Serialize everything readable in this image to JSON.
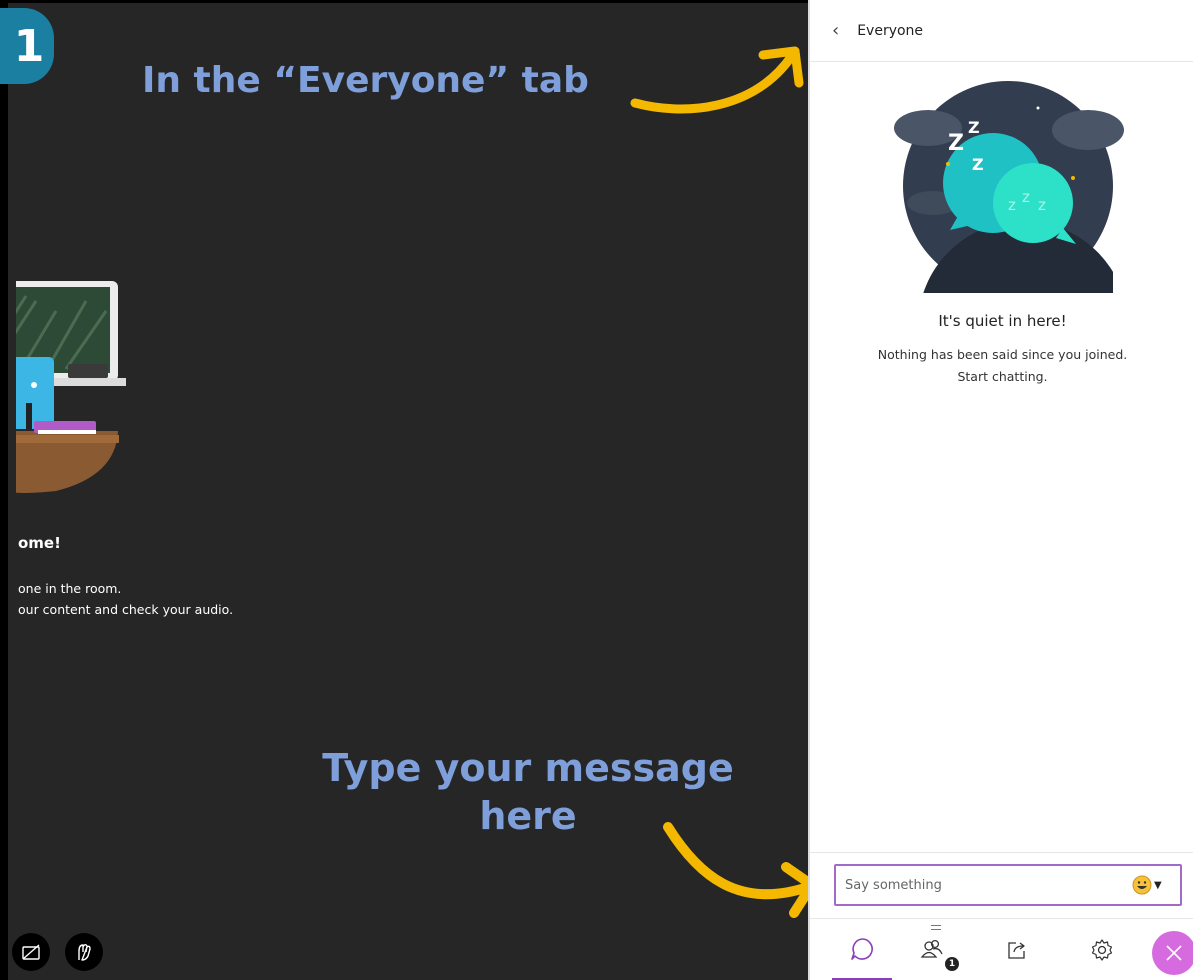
{
  "annotations": {
    "step_number": "1",
    "top_callout": "In the “Everyone” tab",
    "bottom_callout": "Type your message here",
    "arrow_color": "#f5b800",
    "callout_color": "#7e9fd9"
  },
  "stage": {
    "welcome_title": "ome!",
    "welcome_line1": "one in the room.",
    "welcome_line2": "our content and check your audio.",
    "buttons": [
      {
        "icon": "camera-off-icon"
      },
      {
        "icon": "raise-hand-icon"
      }
    ]
  },
  "panel": {
    "back_icon": "chevron-left-icon",
    "title": "Everyone",
    "empty_state": {
      "title": "It's quiet in here!",
      "line1": "Nothing has been said since you joined.",
      "line2": "Start chatting."
    },
    "composer": {
      "placeholder": "Say something",
      "emoji_icon": "emoji-smile-icon"
    },
    "tabs": [
      {
        "icon": "chat-bubble-icon",
        "active": true
      },
      {
        "icon": "attendees-icon",
        "badge": "1"
      },
      {
        "icon": "share-content-icon"
      },
      {
        "icon": "settings-icon"
      },
      {
        "icon": "close-icon"
      }
    ],
    "accent_color": "#8b3fb8"
  }
}
